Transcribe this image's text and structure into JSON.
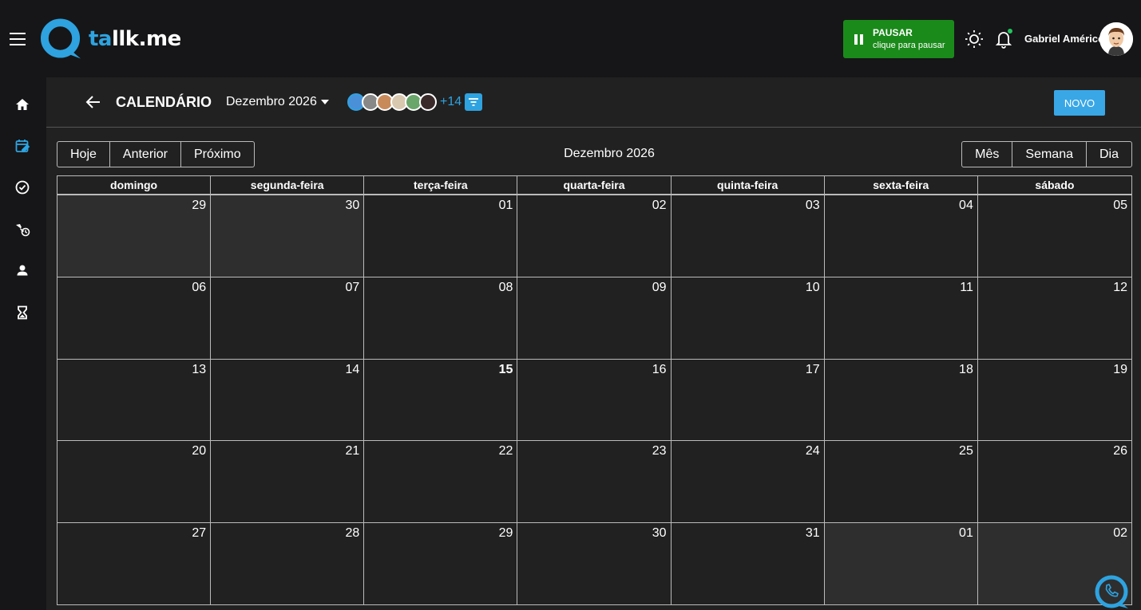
{
  "app": {
    "logo_text_blue": "ta",
    "logo_text_white": "llk.me",
    "accent_color": "#2ea3e0",
    "pause_color": "#1a8a1a"
  },
  "topbar": {
    "pause_title": "PAUSAR",
    "pause_subtitle": "clique para pausar",
    "user_name": "Gabriel Américo",
    "icons": [
      "menu-icon",
      "sun-icon",
      "bell-icon"
    ]
  },
  "sidebar": {
    "items": [
      {
        "icon": "home-icon"
      },
      {
        "icon": "calendar-edit-icon",
        "active": true
      },
      {
        "icon": "check-circle-icon"
      },
      {
        "icon": "phone-clock-icon"
      },
      {
        "icon": "user-icon"
      },
      {
        "icon": "hourglass-icon"
      }
    ]
  },
  "header": {
    "title": "CALENDÁRIO",
    "month_select": "Dezembro 2026",
    "extra_count": "+14",
    "new_button": "NOVO"
  },
  "toolbar": {
    "today": "Hoje",
    "prev": "Anterior",
    "next": "Próximo",
    "title": "Dezembro 2026",
    "view_month": "Mês",
    "view_week": "Semana",
    "view_day": "Dia"
  },
  "calendar": {
    "weekdays": [
      "domingo",
      "segunda-feira",
      "terça-feira",
      "quarta-feira",
      "quinta-feira",
      "sexta-feira",
      "sábado"
    ],
    "weeks": [
      [
        {
          "d": "29",
          "o": true
        },
        {
          "d": "30",
          "o": true
        },
        {
          "d": "01"
        },
        {
          "d": "02"
        },
        {
          "d": "03"
        },
        {
          "d": "04"
        },
        {
          "d": "05"
        }
      ],
      [
        {
          "d": "06"
        },
        {
          "d": "07"
        },
        {
          "d": "08"
        },
        {
          "d": "09"
        },
        {
          "d": "10"
        },
        {
          "d": "11"
        },
        {
          "d": "12"
        }
      ],
      [
        {
          "d": "13"
        },
        {
          "d": "14"
        },
        {
          "d": "15",
          "t": true
        },
        {
          "d": "16"
        },
        {
          "d": "17"
        },
        {
          "d": "18"
        },
        {
          "d": "19"
        }
      ],
      [
        {
          "d": "20"
        },
        {
          "d": "21"
        },
        {
          "d": "22"
        },
        {
          "d": "23"
        },
        {
          "d": "24"
        },
        {
          "d": "25"
        },
        {
          "d": "26"
        }
      ],
      [
        {
          "d": "27"
        },
        {
          "d": "28"
        },
        {
          "d": "29"
        },
        {
          "d": "30"
        },
        {
          "d": "31"
        },
        {
          "d": "01",
          "o": true
        },
        {
          "d": "02",
          "o": true
        }
      ]
    ]
  }
}
